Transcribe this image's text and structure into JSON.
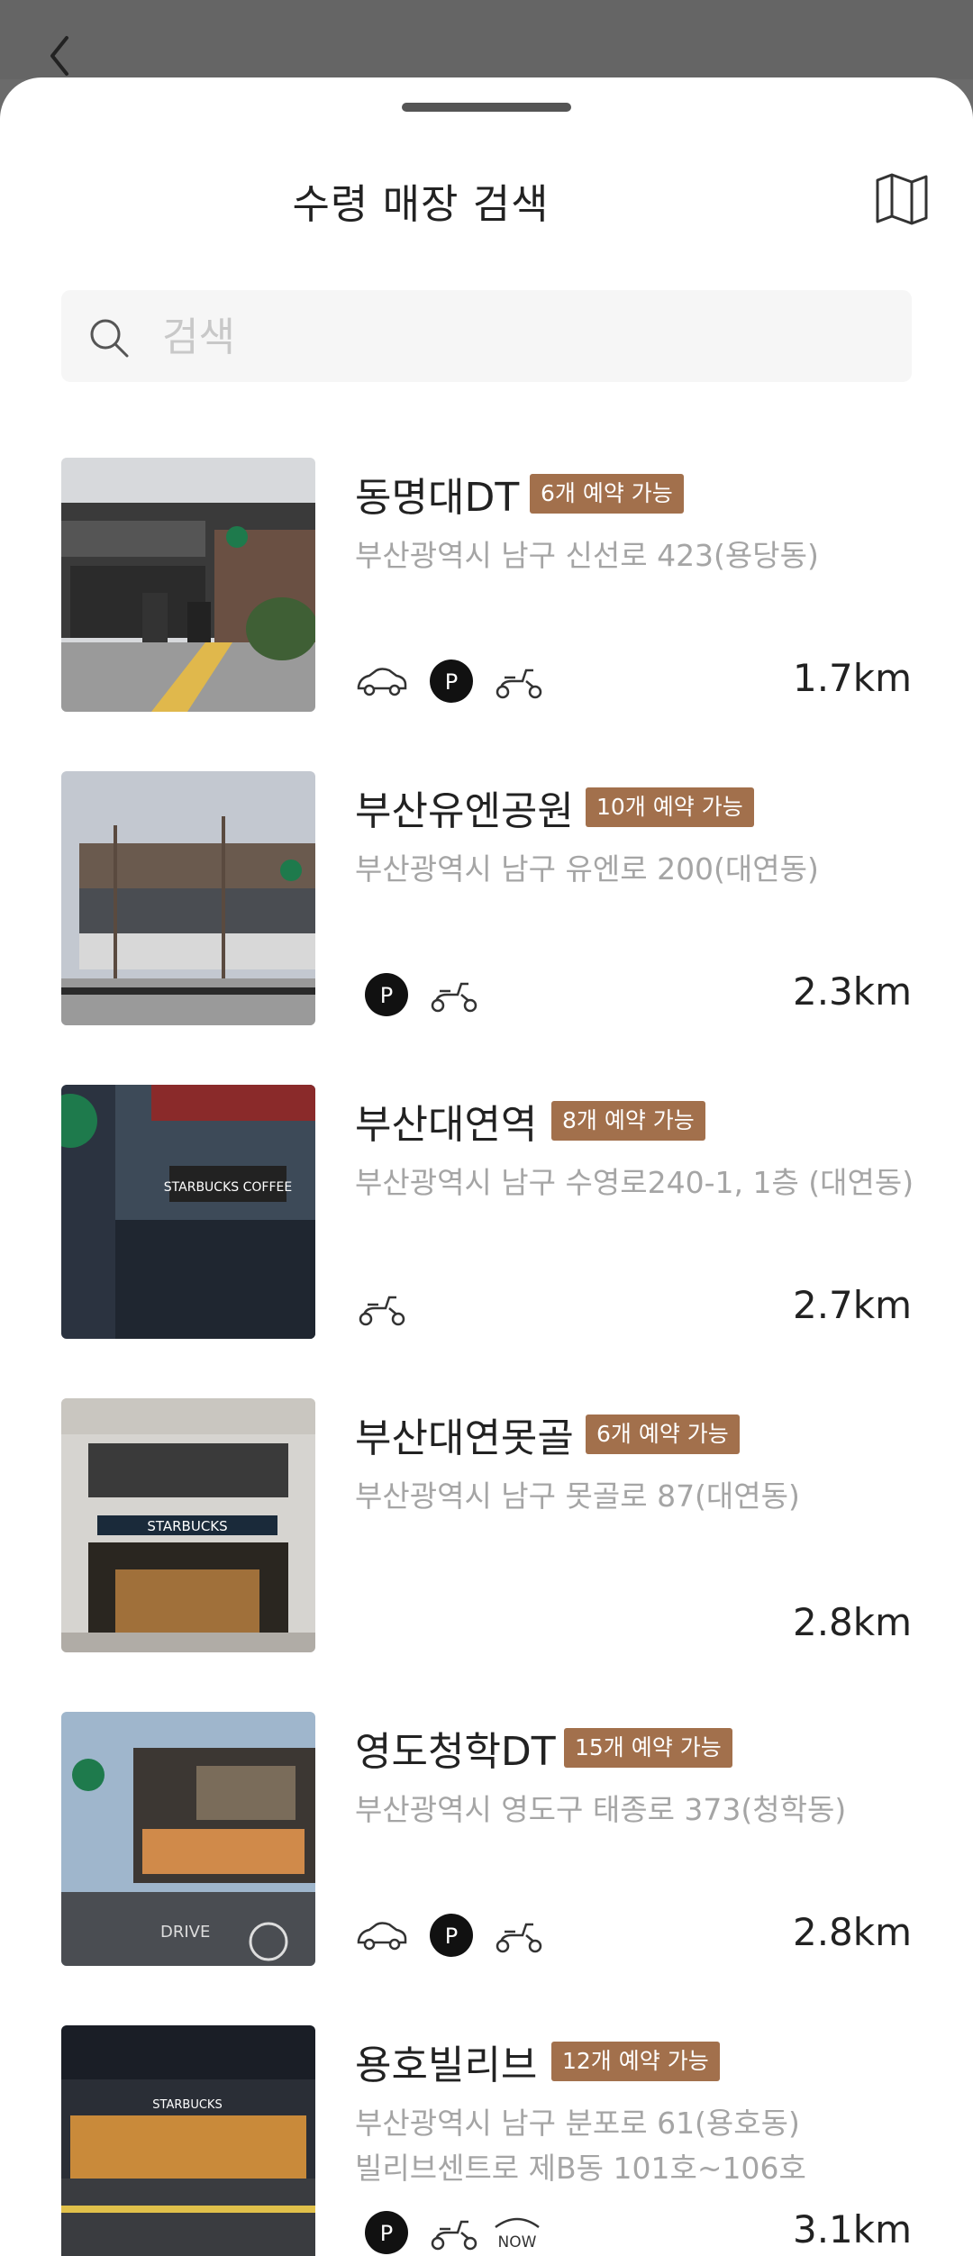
{
  "header": {
    "title": "수령 매장 검색"
  },
  "search": {
    "placeholder": "검색"
  },
  "stores": [
    {
      "name": "동명대DT",
      "badge": "6개 예약 가능",
      "address": [
        "부산광역시 남구 신선로 423(용당동)"
      ],
      "icons": [
        "car-icon",
        "parking-icon",
        "scooter-icon"
      ],
      "distance": "1.7km"
    },
    {
      "name": "부산유엔공원",
      "badge": "10개 예약 가능",
      "address": [
        "부산광역시 남구 유엔로 200(대연동)"
      ],
      "icons": [
        "parking-icon",
        "scooter-icon"
      ],
      "distance": "2.3km"
    },
    {
      "name": "부산대연역",
      "badge": "8개 예약 가능",
      "address": [
        "부산광역시 남구 수영로240-1, 1층 (대연동)"
      ],
      "icons": [
        "scooter-icon"
      ],
      "distance": "2.7km"
    },
    {
      "name": "부산대연못골",
      "badge": "6개 예약 가능",
      "address": [
        "부산광역시 남구 못골로 87(대연동)"
      ],
      "icons": [],
      "distance": "2.8km"
    },
    {
      "name": "영도청학DT",
      "badge": "15개 예약 가능",
      "address": [
        "부산광역시 영도구 태종로 373(청학동)"
      ],
      "icons": [
        "car-icon",
        "parking-icon",
        "scooter-icon"
      ],
      "distance": "2.8km"
    },
    {
      "name": "용호빌리브",
      "badge": "12개 예약 가능",
      "address": [
        "부산광역시 남구 분포로 61(용호동)",
        "빌리브센트로 제B동 101호~106호"
      ],
      "icons": [
        "parking-icon",
        "scooter-icon",
        "now-icon"
      ],
      "distance": "3.1km",
      "now_label": "NOW"
    }
  ],
  "colors": {
    "badge": "#a2704c",
    "address": "#a5a5a5",
    "search_bg": "#f6f6f6"
  }
}
